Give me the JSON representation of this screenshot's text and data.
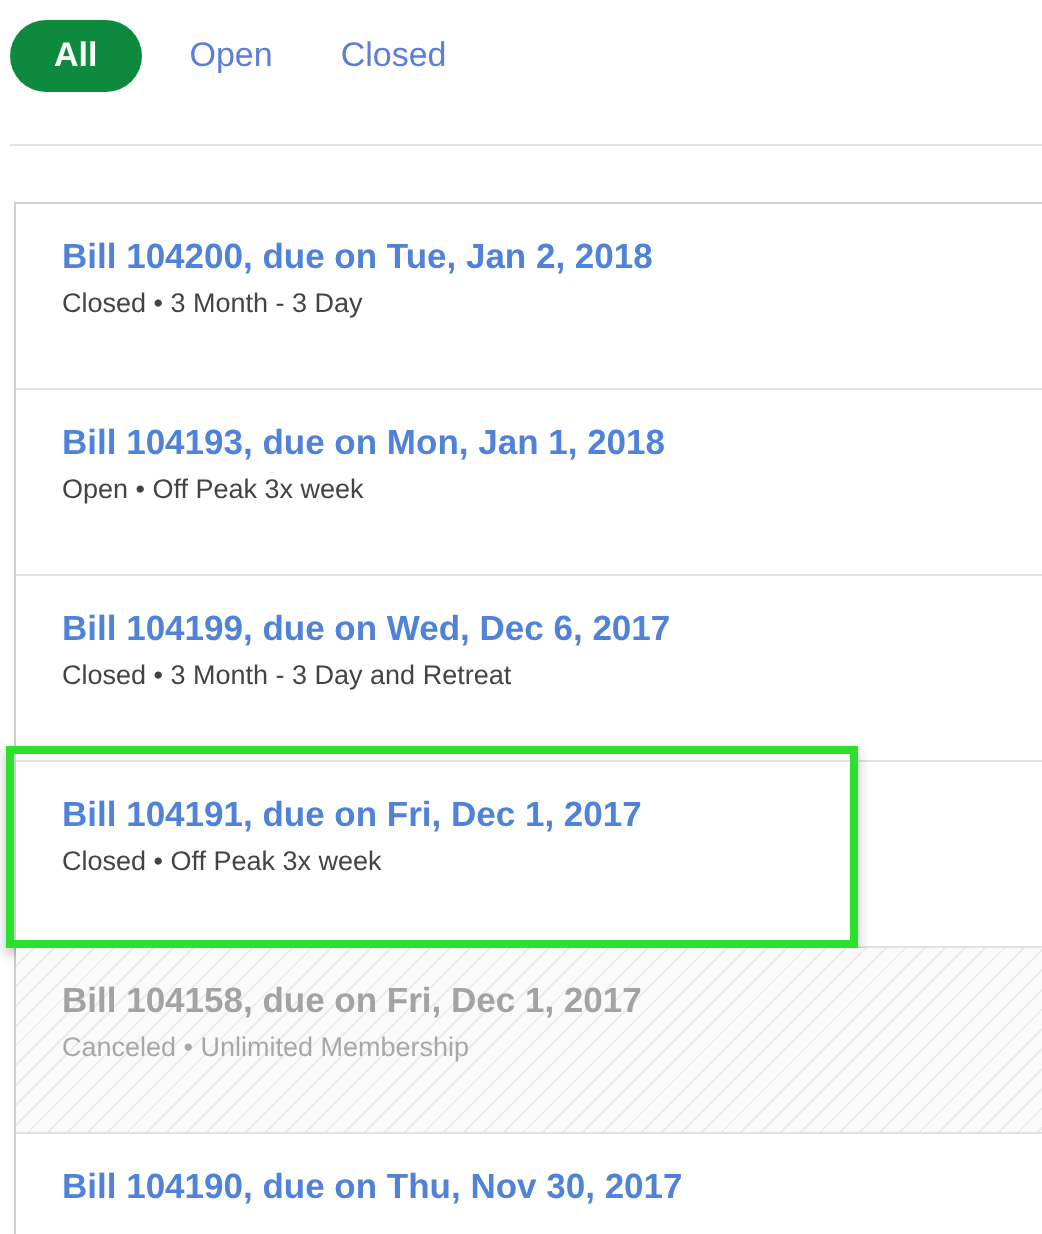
{
  "tabs": [
    {
      "label": "All",
      "selected": true
    },
    {
      "label": "Open",
      "selected": false
    },
    {
      "label": "Closed",
      "selected": false
    }
  ],
  "bills": [
    {
      "title": "Bill 104200, due on Tue, Jan 2, 2018",
      "subtitle": "Closed • 3 Month - 3 Day",
      "disabled": false,
      "highlighted": false
    },
    {
      "title": "Bill 104193, due on Mon, Jan 1, 2018",
      "subtitle": "Open • Off Peak 3x week",
      "disabled": false,
      "highlighted": false
    },
    {
      "title": "Bill 104199, due on Wed, Dec 6, 2017",
      "subtitle": "Closed • 3 Month - 3 Day and Retreat",
      "disabled": false,
      "highlighted": false
    },
    {
      "title": "Bill 104191, due on Fri, Dec 1, 2017",
      "subtitle": "Closed • Off Peak 3x week",
      "disabled": false,
      "highlighted": true
    },
    {
      "title": "Bill 104158, due on Fri, Dec 1, 2017",
      "subtitle": "Canceled • Unlimited Membership",
      "disabled": true,
      "highlighted": false
    },
    {
      "title": "Bill 104190, due on Thu, Nov 30, 2017",
      "disabled": false,
      "highlighted": false
    }
  ]
}
